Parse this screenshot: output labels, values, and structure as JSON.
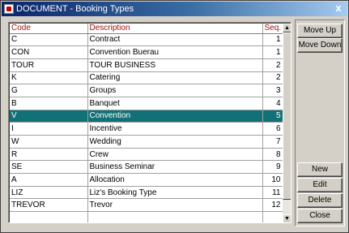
{
  "window": {
    "title": "DOCUMENT - Booking Types",
    "close_glyph": "x"
  },
  "grid": {
    "columns": {
      "code": "Code",
      "description": "Description",
      "seq": "Seq."
    },
    "rows": [
      {
        "code": "C",
        "description": "Contract",
        "seq": "1"
      },
      {
        "code": "CON",
        "description": "Convention Buerau",
        "seq": "1"
      },
      {
        "code": "TOUR",
        "description": "TOUR BUSINESS",
        "seq": "2"
      },
      {
        "code": "K",
        "description": "Catering",
        "seq": "2"
      },
      {
        "code": "G",
        "description": "Groups",
        "seq": "3"
      },
      {
        "code": "B",
        "description": "Banquet",
        "seq": "4"
      },
      {
        "code": "V",
        "description": "Convention",
        "seq": "5",
        "selected": true
      },
      {
        "code": "I",
        "description": "Incentive",
        "seq": "6"
      },
      {
        "code": "W",
        "description": "Wedding",
        "seq": "7"
      },
      {
        "code": "R",
        "description": "Crew",
        "seq": "8"
      },
      {
        "code": "SE",
        "description": "Business Seminar",
        "seq": "9"
      },
      {
        "code": "A",
        "description": "Allocation",
        "seq": "10"
      },
      {
        "code": "LIZ",
        "description": "Liz's Booking Type",
        "seq": "11"
      },
      {
        "code": "TREVOR",
        "description": "Trevor",
        "seq": "12"
      },
      {
        "code": "",
        "description": "",
        "seq": ""
      }
    ],
    "selected_color": "#127176"
  },
  "buttons": {
    "move_up": "Move Up",
    "move_down": "Move Down",
    "new": "New",
    "edit": "Edit",
    "delete": "Delete",
    "close": "Close"
  }
}
